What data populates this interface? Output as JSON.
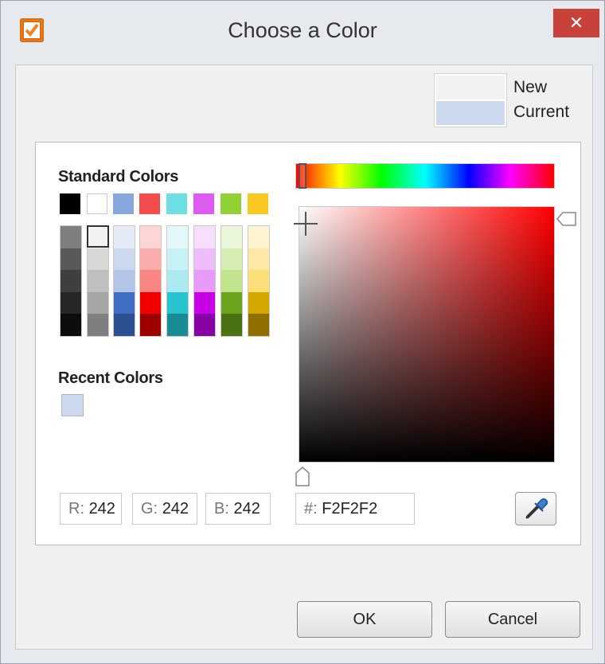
{
  "window": {
    "title": "Choose a Color",
    "close_symbol": "✕",
    "accent": "#f08324",
    "close_color": "#c9413b"
  },
  "preview": {
    "new_label": "New",
    "current_label": "Current",
    "new_color": "#F2F2F2",
    "current_color": "#CCD9EE"
  },
  "standard": {
    "title": "Standard Colors",
    "top_row": [
      "#000000",
      "#FFFFFF",
      "#86A8DB",
      "#F44B4B",
      "#6DDEE3",
      "#DB5BF4",
      "#92D136",
      "#F9C922"
    ],
    "columns": [
      [
        "#7F7F7F",
        "#595959",
        "#3F3F3F",
        "#262626",
        "#0D0D0D"
      ],
      [
        "#F2F2F2",
        "#D8D8D8",
        "#BFBFBF",
        "#A5A5A5",
        "#7F7F7F"
      ],
      [
        "#E5EBF6",
        "#CBD8EE",
        "#B2C5E6",
        "#3F6FC4",
        "#2A5091"
      ],
      [
        "#FDD5D5",
        "#FBADAD",
        "#F98585",
        "#F20000",
        "#9E0000"
      ],
      [
        "#E2F8FA",
        "#C6F1F5",
        "#AAEAF0",
        "#27C3CF",
        "#188C94"
      ],
      [
        "#F7DEFD",
        "#EFBDFB",
        "#E79CF9",
        "#C800E6",
        "#8700A3"
      ],
      [
        "#EAF6D9",
        "#D6EDB3",
        "#C1E48D",
        "#6BA51E",
        "#4A7214"
      ],
      [
        "#FEF4D2",
        "#FDE9A5",
        "#FCDF78",
        "#D3A600",
        "#8E6F00"
      ]
    ]
  },
  "recent": {
    "title": "Recent Colors",
    "colors": [
      "#CCD9EE"
    ]
  },
  "fields": {
    "r_label": "R:",
    "r_value": "242",
    "g_label": "G:",
    "g_value": "242",
    "b_label": "B:",
    "b_value": "242",
    "hex_label": "#:",
    "hex_value": "F2F2F2"
  },
  "buttons": {
    "ok": "OK",
    "cancel": "Cancel"
  },
  "icons": {
    "app": "checkbox-icon",
    "eyedropper": "eyedropper-icon"
  }
}
